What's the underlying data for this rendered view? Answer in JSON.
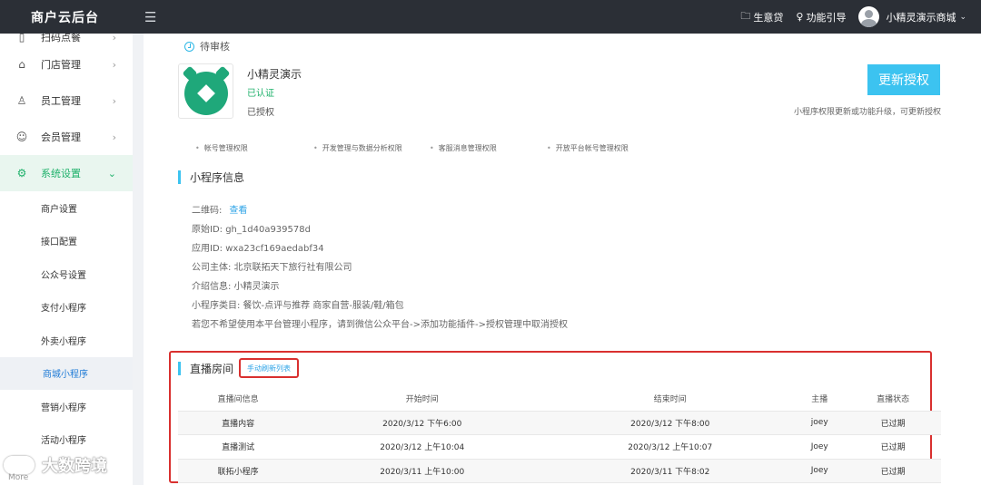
{
  "header": {
    "brand": "商户云后台",
    "menu_icon": "hamburger-icon",
    "links": [
      {
        "icon": "folder-icon",
        "label": "生意贷"
      },
      {
        "icon": "bulb-icon",
        "label": "功能引导"
      }
    ],
    "user_name": "小精灵演示商城"
  },
  "sidebar": {
    "items": [
      {
        "icon": "scan-order-icon",
        "label": "扫码点餐"
      },
      {
        "icon": "home-icon",
        "label": "门店管理"
      },
      {
        "icon": "user-icon",
        "label": "员工管理"
      },
      {
        "icon": "smile-icon",
        "label": "会员管理"
      },
      {
        "icon": "gear-icon",
        "label": "系统设置"
      }
    ],
    "subitems": [
      "商户设置",
      "接口配置",
      "公众号设置",
      "支付小程序",
      "外卖小程序",
      "商城小程序",
      "营销小程序",
      "活动小程序"
    ],
    "active_subitem": "商城小程序"
  },
  "status": {
    "pending": "待审核"
  },
  "app": {
    "name": "小精灵演示",
    "verified": "已认证",
    "authorized": "已授权",
    "update_button": "更新授权",
    "update_hint": "小程序权限更新或功能升级，可更新授权"
  },
  "permissions": [
    "帐号管理权限",
    "开发管理与数据分析权限",
    "客服消息管理权限",
    "开放平台帐号管理权限"
  ],
  "mini_info": {
    "title": "小程序信息",
    "qr_label": "二维码:",
    "qr_link": "查看",
    "original_id": "原始ID:  gh_1d40a939578d",
    "app_id": "应用ID:  wxa23cf169aedabf34",
    "company": "公司主体:  北京联拓天下旅行社有限公司",
    "intro": "介绍信息:  小精灵演示",
    "category": "小程序类目:   餐饮-点评与推荐 商家自营-服装/鞋/箱包",
    "notice": "若您不希望使用本平台管理小程序，请到微信公众平台->添加功能插件->授权管理中取消授权"
  },
  "live": {
    "title": "直播房间",
    "refresh": "手动刷新列表",
    "columns": [
      "直播间信息",
      "开始时间",
      "结束时间",
      "主播",
      "直播状态"
    ],
    "rows": [
      [
        "直播内容",
        "2020/3/12 下午6:00",
        "2020/3/12 下午8:00",
        "joey",
        "已过期"
      ],
      [
        "直播测试",
        "2020/3/12 上午10:04",
        "2020/3/12 上午10:07",
        "Joey",
        "已过期"
      ],
      [
        "联拓小程序",
        "2020/3/11 上午10:00",
        "2020/3/11 下午8:02",
        "Joey",
        "已过期"
      ]
    ]
  },
  "watermark": "大数跨境",
  "more_label": "More"
}
